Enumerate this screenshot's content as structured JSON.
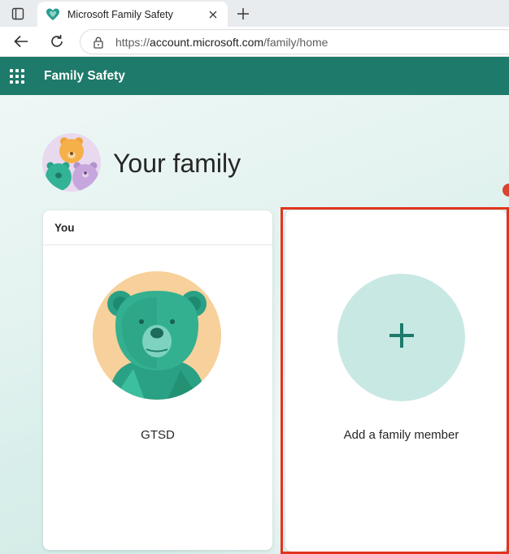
{
  "browser": {
    "tab_title": "Microsoft Family Safety",
    "url_prefix": "https://",
    "url_host": "account.microsoft.com",
    "url_path": "/family/home"
  },
  "app": {
    "title": "Family Safety"
  },
  "main": {
    "heading": "Your family",
    "members": [
      {
        "section_label": "You",
        "name": "GTSD"
      }
    ],
    "add_member_label": "Add a family member"
  },
  "colors": {
    "brand_header": "#1e7a6a",
    "add_circle": "#c8e8e4",
    "plus": "#1e7a6a",
    "annotation_box": "#e1341e"
  },
  "icons": [
    "tab-actions-icon",
    "family-safety-favicon",
    "close-icon",
    "new-tab-icon",
    "back-arrow-icon",
    "reload-icon",
    "lock-icon",
    "app-launcher-icon",
    "plus-icon"
  ]
}
